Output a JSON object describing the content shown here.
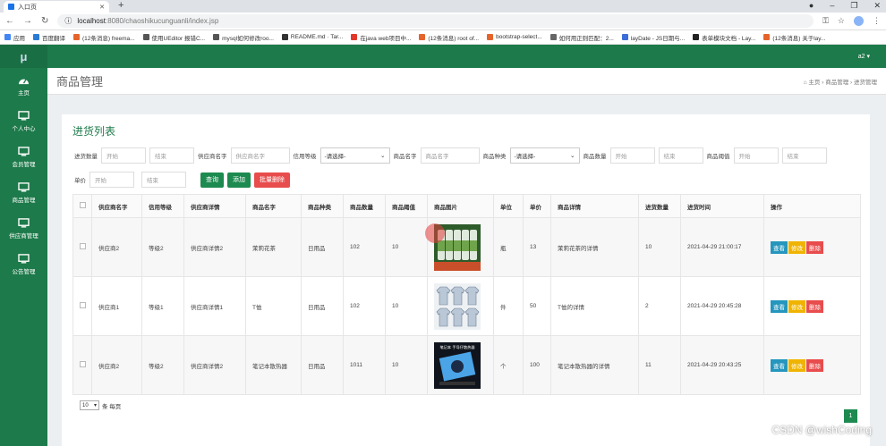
{
  "browser": {
    "tab_title": "入口页",
    "new_tab": "+",
    "url_host": "localhost",
    "url_path": ":8080/chaoshikucunguanli/index.jsp",
    "bookmarks": [
      "应用",
      "百度翻译",
      "(12条消息) freema...",
      "使用UEditor 报错C...",
      "mysql如何修改roo...",
      "README.md · Tar...",
      "在java web项目中...",
      "(12条消息) root of...",
      "bootstrap-select...",
      "如何用正则匹配：2...",
      "layDate - JS日期与...",
      "表单模块文档 - Lay...",
      "(12条消息) 关于lay..."
    ],
    "bookmark_colors": [
      "#4285f4",
      "#2a7bd6",
      "#e5642c",
      "#555",
      "#555",
      "#333",
      "#e2382c",
      "#e5642c",
      "#e5642c",
      "#666",
      "#3b6ed8",
      "#222",
      "#e5642c"
    ]
  },
  "app": {
    "logo": "μ",
    "user": "a2 ▾",
    "sidebar": [
      "主页",
      "个人中心",
      "会员管理",
      "商品管理",
      "供应商管理",
      "公告管理"
    ],
    "page_title": "商品管理",
    "breadcrumb": "⌂ 主页  ›  商品管理  ›  进货管理",
    "list_title": "进货列表"
  },
  "filters": {
    "row1": [
      {
        "label": "进货数量",
        "inputs": [
          "开始",
          "结束"
        ]
      },
      {
        "label": "供应商名字",
        "inputs": [
          "供应商名字"
        ]
      },
      {
        "label": "信用等级",
        "select": "-请选择-"
      },
      {
        "label": "商品名字",
        "inputs": [
          "商品名字"
        ]
      },
      {
        "label": "商品种类",
        "select": "-请选择-"
      },
      {
        "label": "商品数量",
        "inputs": [
          "开始",
          "结束"
        ]
      },
      {
        "label": "商品阈值",
        "inputs": [
          "开始",
          "结束"
        ]
      }
    ],
    "row2_label": "单价",
    "row2_inputs": [
      "开始",
      "结束"
    ],
    "buttons": [
      "查询",
      "添加",
      "批量删除"
    ]
  },
  "table": {
    "headers": [
      "",
      "供应商名字",
      "信用等级",
      "供应商详情",
      "商品名字",
      "商品种类",
      "商品数量",
      "商品阈值",
      "商品图片",
      "单位",
      "单价",
      "商品详情",
      "进货数量",
      "进货时间",
      "操作"
    ],
    "rows": [
      {
        "supplier": "供应商2",
        "credit": "等级2",
        "detail": "供应商详情2",
        "name": "茉莉花茶",
        "kind": "日用品",
        "qty": "102",
        "threshold": "10",
        "image": "tea-bottles",
        "unit": "瓶",
        "price": "13",
        "pdetail": "茉莉花茶的详情",
        "in_qty": "10",
        "time": "2021-04-29 21:00:17"
      },
      {
        "supplier": "供应商1",
        "credit": "等级1",
        "detail": "供应商详情1",
        "name": "T恤",
        "kind": "日用品",
        "qty": "102",
        "threshold": "10",
        "image": "tshirts",
        "unit": "件",
        "price": "50",
        "pdetail": "T恤的详情",
        "in_qty": "2",
        "time": "2021-04-29 20:45:28"
      },
      {
        "supplier": "供应商2",
        "credit": "等级2",
        "detail": "供应商详情2",
        "name": "笔记本散热器",
        "kind": "日用品",
        "qty": "1011",
        "threshold": "10",
        "image": "laptop-cooler",
        "unit": "个",
        "price": "100",
        "pdetail": "笔记本散热器的详情",
        "in_qty": "11",
        "time": "2021-04-29 20:43:25",
        "image_caption": "笔记本 手导仔散热器"
      }
    ],
    "actions": [
      "查看",
      "修改",
      "删除"
    ]
  },
  "pagination": {
    "size": "10",
    "label": "条 每页",
    "page": "1"
  },
  "watermark": "CSDN @wishCoding"
}
